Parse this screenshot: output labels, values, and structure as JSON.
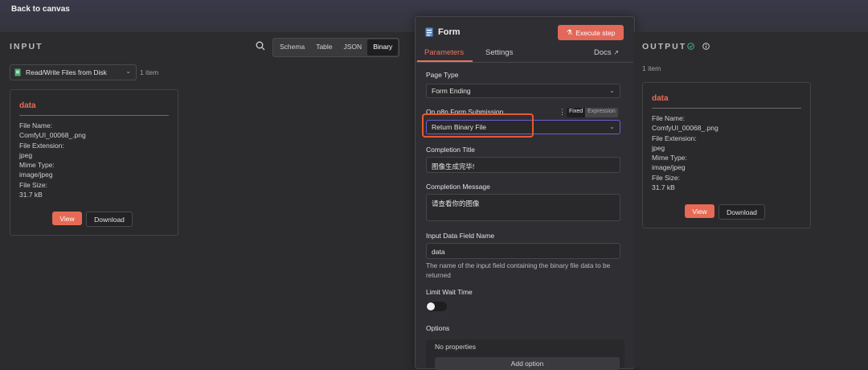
{
  "topbar": {
    "back_label": "Back to canvas"
  },
  "input": {
    "title": "INPUT",
    "tabs": [
      "Schema",
      "Table",
      "JSON",
      "Binary"
    ],
    "active_tab": "Binary",
    "node_select": "Read/Write Files from Disk",
    "item_count": "1 item",
    "card": {
      "title": "data",
      "lines": [
        "File Name:",
        "ComfyUI_00068_.png",
        "File Extension:",
        "jpeg",
        "Mime Type:",
        "image/jpeg",
        "File Size:",
        "31.7 kB"
      ],
      "view_label": "View",
      "download_label": "Download"
    }
  },
  "form": {
    "title": "Form",
    "execute_label": "Execute step",
    "tabs": {
      "parameters": "Parameters",
      "settings": "Settings",
      "docs": "Docs"
    },
    "page_type_label": "Page Type",
    "page_type_value": "Form Ending",
    "on_submit_label": "On n8n Form Submission",
    "fixed_label": "Fixed",
    "expression_label": "Expression",
    "on_submit_value": "Return Binary File",
    "completion_title_label": "Completion Title",
    "completion_title_value": "图像生成完毕!",
    "completion_message_label": "Completion Message",
    "completion_message_value": "请查看你的图像",
    "input_field_label": "Input Data Field Name",
    "input_field_value": "data",
    "input_field_help": "The name of the input field containing the binary file data to be returned",
    "limit_wait_label": "Limit Wait Time",
    "options_label": "Options",
    "no_properties": "No properties",
    "add_option": "Add option"
  },
  "output": {
    "title": "OUTPUT",
    "item_count": "1 item",
    "card": {
      "title": "data",
      "lines": [
        "File Name:",
        "ComfyUI_00068_.png",
        "File Extension:",
        "jpeg",
        "Mime Type:",
        "image/jpeg",
        "File Size:",
        "31.7 kB"
      ],
      "view_label": "View",
      "download_label": "Download"
    }
  },
  "colors": {
    "accent": "#e66a55",
    "highlight": "#e8592f",
    "success": "#3fb37f"
  }
}
